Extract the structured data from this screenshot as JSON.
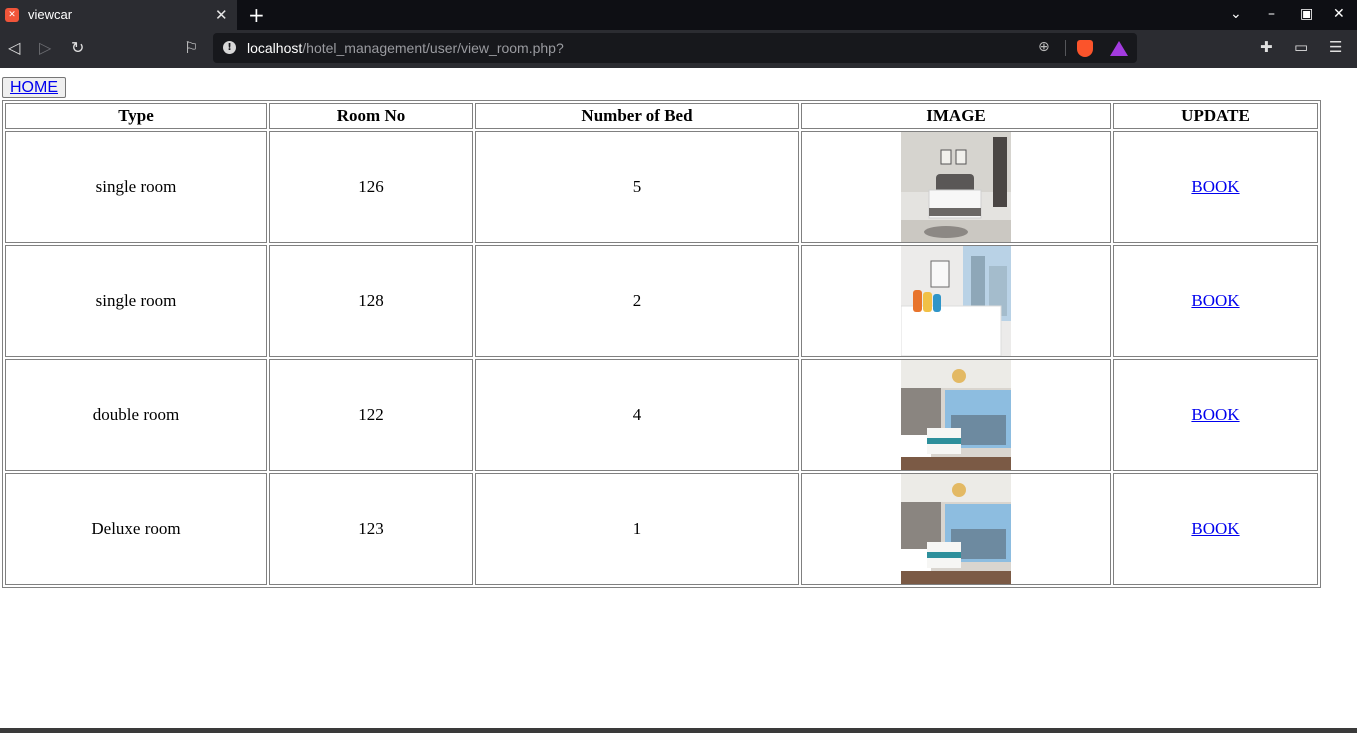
{
  "browser": {
    "tab_title": "viewcar",
    "url_host": "localhost",
    "url_path": "/hotel_management/user/view_room.php?"
  },
  "page": {
    "home_label": "HOME",
    "table": {
      "headers": [
        "Type",
        "Room No",
        "Number of Bed",
        "IMAGE",
        "UPDATE"
      ],
      "rows": [
        {
          "type": "single room",
          "room_no": "126",
          "beds": "5",
          "action": "BOOK"
        },
        {
          "type": "single room",
          "room_no": "128",
          "beds": "2",
          "action": "BOOK"
        },
        {
          "type": "double room",
          "room_no": "122",
          "beds": "4",
          "action": "BOOK"
        },
        {
          "type": "Deluxe room",
          "room_no": "123",
          "beds": "1",
          "action": "BOOK"
        }
      ]
    }
  },
  "colors": {
    "link": "#0000ee",
    "tab_bg": "#2b2c31",
    "titlebar_bg": "#0e0f14",
    "brave_orange": "#fb542b"
  }
}
